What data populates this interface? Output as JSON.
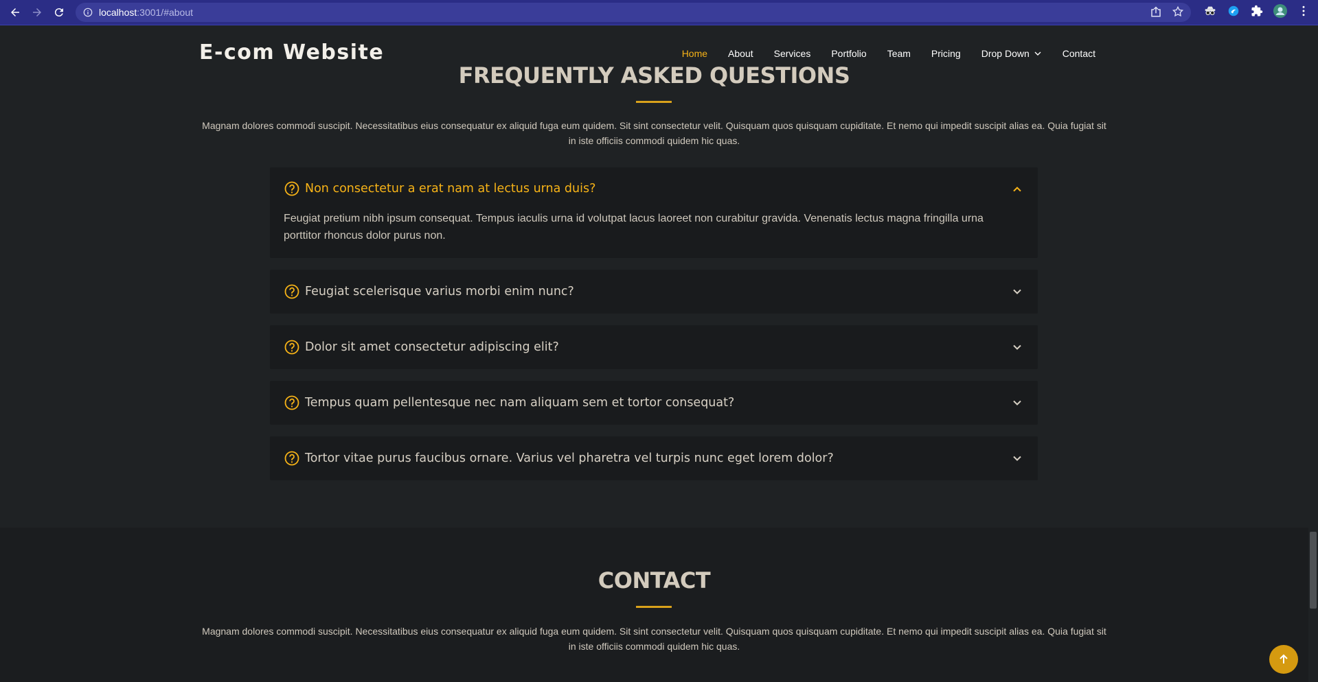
{
  "browser": {
    "url_host": "localhost",
    "url_rest": ":3001/#about"
  },
  "header": {
    "logo": "E-com Website",
    "nav": [
      {
        "label": "Home",
        "active": true
      },
      {
        "label": "About"
      },
      {
        "label": "Services"
      },
      {
        "label": "Portfolio"
      },
      {
        "label": "Team"
      },
      {
        "label": "Pricing"
      },
      {
        "label": "Drop Down",
        "has_dropdown": true
      },
      {
        "label": "Contact"
      }
    ]
  },
  "faq": {
    "title": "FREQUENTLY ASKED QUESTIONS",
    "description": "Magnam dolores commodi suscipit. Necessitatibus eius consequatur ex aliquid fuga eum quidem. Sit sint consectetur velit. Quisquam quos quisquam cupiditate. Et nemo qui impedit suscipit alias ea. Quia fugiat sit in iste officiis commodi quidem hic quas.",
    "items": [
      {
        "question": "Non consectetur a erat nam at lectus urna duis?",
        "answer": "Feugiat pretium nibh ipsum consequat. Tempus iaculis urna id volutpat lacus laoreet non curabitur gravida. Venenatis lectus magna fringilla urna porttitor rhoncus dolor purus non.",
        "open": true
      },
      {
        "question": "Feugiat scelerisque varius morbi enim nunc?",
        "open": false
      },
      {
        "question": "Dolor sit amet consectetur adipiscing elit?",
        "open": false
      },
      {
        "question": "Tempus quam pellentesque nec nam aliquam sem et tortor consequat?",
        "open": false
      },
      {
        "question": "Tortor vitae purus faucibus ornare. Varius vel pharetra vel turpis nunc eget lorem dolor?",
        "open": false
      }
    ]
  },
  "contact": {
    "title": "CONTACT",
    "description": "Magnam dolores commodi suscipit. Necessitatibus eius consequatur ex aliquid fuga eum quidem. Sit sint consectetur velit. Quisquam quos quisquam cupiditate. Et nemo qui impedit suscipit alias ea. Quia fugiat sit in iste officiis commodi quidem hic quas."
  },
  "colors": {
    "accent": "#f7b317",
    "browser_bar": "#2b2d86",
    "page_bg": "#1f2224",
    "card_bg": "#191b1d"
  }
}
